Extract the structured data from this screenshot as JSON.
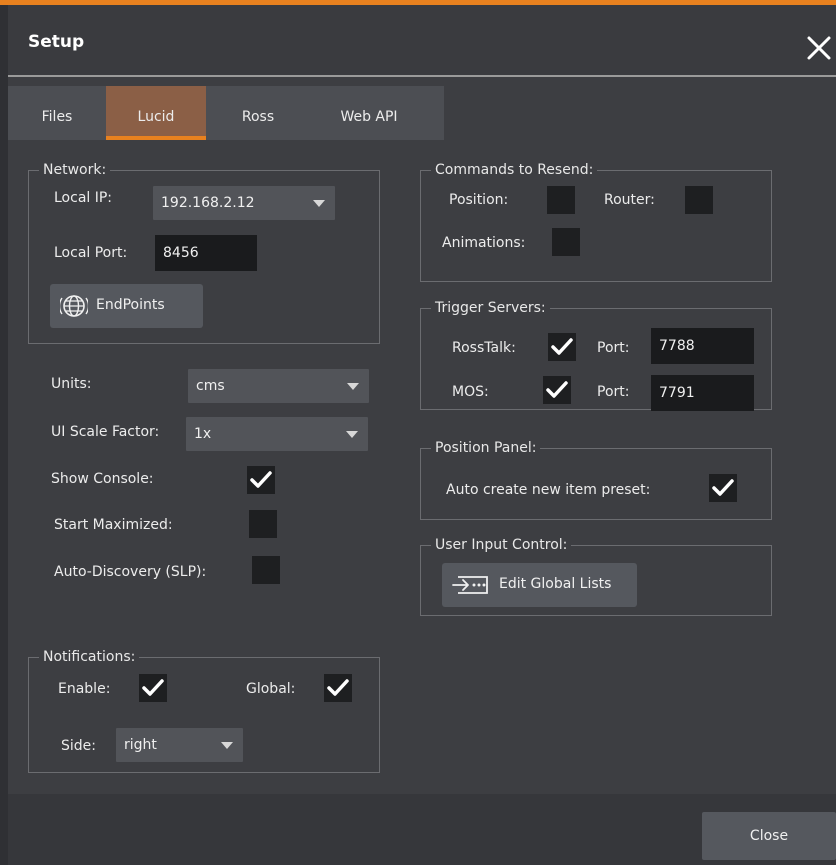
{
  "dialog": {
    "title": "Setup"
  },
  "tabs": [
    {
      "label": "Files",
      "active": false
    },
    {
      "label": "Lucid",
      "active": true
    },
    {
      "label": "Ross",
      "active": false
    },
    {
      "label": "Web API",
      "active": false
    }
  ],
  "network": {
    "legend": "Network:",
    "local_ip_label": "Local IP:",
    "local_ip_value": "192.168.2.12",
    "local_port_label": "Local Port:",
    "local_port_value": "8456",
    "endpoints_label": "EndPoints",
    "endpoints_icon": "network-globe-icon"
  },
  "settings": {
    "units_label": "Units:",
    "units_value": "cms",
    "ui_scale_label": "UI Scale Factor:",
    "ui_scale_value": "1x",
    "show_console_label": "Show Console:",
    "show_console_checked": true,
    "start_maximized_label": "Start Maximized:",
    "start_maximized_checked": false,
    "auto_discovery_label": "Auto-Discovery (SLP):",
    "auto_discovery_checked": false
  },
  "notifications": {
    "legend": "Notifications:",
    "enable_label": "Enable:",
    "enable_checked": true,
    "global_label": "Global:",
    "global_checked": true,
    "side_label": "Side:",
    "side_value": "right"
  },
  "commands_to_resend": {
    "legend": "Commands to Resend:",
    "position_label": "Position:",
    "position_checked": false,
    "router_label": "Router:",
    "router_checked": false,
    "animations_label": "Animations:",
    "animations_checked": false
  },
  "trigger_servers": {
    "legend": "Trigger Servers:",
    "rosstalk_label": "RossTalk:",
    "rosstalk_checked": true,
    "rosstalk_port_label": "Port:",
    "rosstalk_port_value": "7788",
    "mos_label": "MOS:",
    "mos_checked": true,
    "mos_port_label": "Port:",
    "mos_port_value": "7791"
  },
  "position_panel": {
    "legend": "Position Panel:",
    "auto_create_label": "Auto create new item preset:",
    "auto_create_checked": true
  },
  "user_input_control": {
    "legend": "User Input Control:",
    "edit_global_lists_label": "Edit Global Lists",
    "edit_global_lists_icon": "input-arrow-icon"
  },
  "footer": {
    "close_label": "Close"
  },
  "colors": {
    "accent": "#e8811f",
    "active_tab": "#8b5f46",
    "background": "#3d3e42"
  }
}
